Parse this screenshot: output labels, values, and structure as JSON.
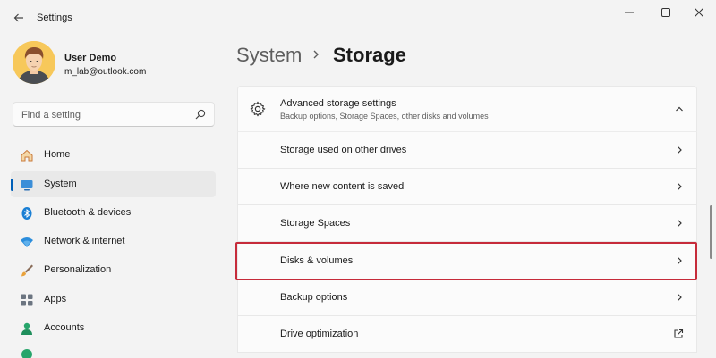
{
  "window": {
    "title": "Settings",
    "controls": [
      "minimize",
      "maximize",
      "close"
    ]
  },
  "profile": {
    "name": "User Demo",
    "email": "m_lab@outlook.com"
  },
  "search": {
    "placeholder": "Find a setting"
  },
  "sidebar": {
    "items": [
      {
        "label": "Home",
        "icon": "home-icon",
        "selected": false
      },
      {
        "label": "System",
        "icon": "system-icon",
        "selected": true
      },
      {
        "label": "Bluetooth & devices",
        "icon": "bluetooth-icon",
        "selected": false
      },
      {
        "label": "Network & internet",
        "icon": "network-icon",
        "selected": false
      },
      {
        "label": "Personalization",
        "icon": "brush-icon",
        "selected": false
      },
      {
        "label": "Apps",
        "icon": "apps-icon",
        "selected": false
      },
      {
        "label": "Accounts",
        "icon": "accounts-icon",
        "selected": false
      }
    ]
  },
  "header": {
    "root": "System",
    "current": "Storage"
  },
  "advanced": {
    "title": "Advanced storage settings",
    "subtitle": "Backup options, Storage Spaces, other disks and volumes",
    "expanded": true
  },
  "rows": [
    {
      "label": "Storage used on other drives",
      "icon": "chevron-right-icon"
    },
    {
      "label": "Where new content is saved",
      "icon": "chevron-right-icon"
    },
    {
      "label": "Storage Spaces",
      "icon": "chevron-right-icon"
    },
    {
      "label": "Disks & volumes",
      "icon": "chevron-right-icon",
      "highlighted": true
    },
    {
      "label": "Backup options",
      "icon": "chevron-right-icon"
    },
    {
      "label": "Drive optimization",
      "icon": "external-link-icon"
    }
  ],
  "colors": {
    "accent": "#005fb8",
    "highlight_border": "#c62b3a",
    "background": "#f3f3f3",
    "card": "#fbfbfb"
  }
}
